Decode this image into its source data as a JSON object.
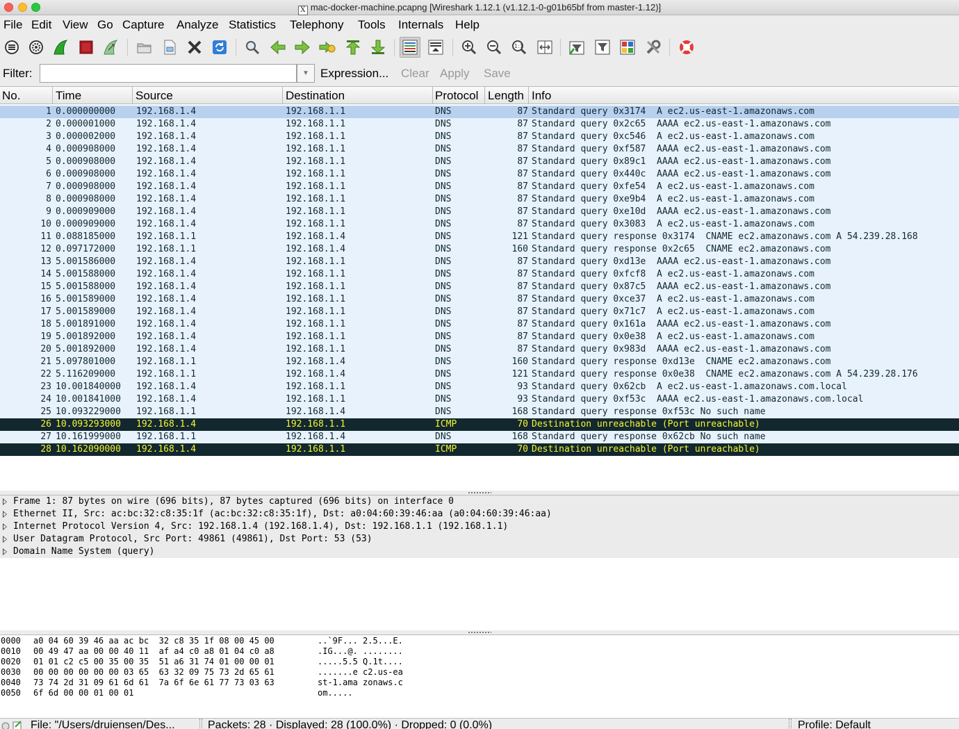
{
  "window": {
    "title": "mac-docker-machine.pcapng  [Wireshark 1.12.1  (v1.12.1-0-g01b65bf from master-1.12)]",
    "badge": "X"
  },
  "menu": [
    "File",
    "Edit",
    "View",
    "Go",
    "Capture",
    "Analyze",
    "Statistics",
    "Telephony",
    "Tools",
    "Internals",
    "Help"
  ],
  "toolbar": {
    "icons": [
      "interfaces-icon",
      "options-icon",
      "start-capture-icon",
      "stop-capture-icon",
      "restart-capture-icon",
      "open-file-icon",
      "save-file-icon",
      "close-file-icon",
      "reload-icon",
      "find-icon",
      "back-icon",
      "forward-icon",
      "go-to-packet-icon",
      "first-packet-icon",
      "last-packet-icon",
      "colorize-icon",
      "autoscroll-icon",
      "zoom-in-icon",
      "zoom-out-icon",
      "normal-size-icon",
      "resize-columns-icon",
      "capture-filters-icon",
      "display-filters-icon",
      "coloring-rules-icon",
      "preferences-icon",
      "help-icon"
    ]
  },
  "filter": {
    "label": "Filter:",
    "value": "",
    "expression": "Expression...",
    "clear": "Clear",
    "apply": "Apply",
    "save": "Save"
  },
  "packet_list": {
    "columns": [
      "No.",
      "Time",
      "Source",
      "Destination",
      "Protocol",
      "Length",
      "Info"
    ],
    "rows": [
      {
        "no": "1",
        "time": "0.000000000",
        "src": "192.168.1.4",
        "dst": "192.168.1.1",
        "proto": "DNS",
        "len": "87",
        "info": "Standard query 0x3174  A ec2.us-east-1.amazonaws.com"
      },
      {
        "no": "2",
        "time": "0.000001000",
        "src": "192.168.1.4",
        "dst": "192.168.1.1",
        "proto": "DNS",
        "len": "87",
        "info": "Standard query 0x2c65  AAAA ec2.us-east-1.amazonaws.com"
      },
      {
        "no": "3",
        "time": "0.000002000",
        "src": "192.168.1.4",
        "dst": "192.168.1.1",
        "proto": "DNS",
        "len": "87",
        "info": "Standard query 0xc546  A ec2.us-east-1.amazonaws.com"
      },
      {
        "no": "4",
        "time": "0.000908000",
        "src": "192.168.1.4",
        "dst": "192.168.1.1",
        "proto": "DNS",
        "len": "87",
        "info": "Standard query 0xf587  AAAA ec2.us-east-1.amazonaws.com"
      },
      {
        "no": "5",
        "time": "0.000908000",
        "src": "192.168.1.4",
        "dst": "192.168.1.1",
        "proto": "DNS",
        "len": "87",
        "info": "Standard query 0x89c1  AAAA ec2.us-east-1.amazonaws.com"
      },
      {
        "no": "6",
        "time": "0.000908000",
        "src": "192.168.1.4",
        "dst": "192.168.1.1",
        "proto": "DNS",
        "len": "87",
        "info": "Standard query 0x440c  AAAA ec2.us-east-1.amazonaws.com"
      },
      {
        "no": "7",
        "time": "0.000908000",
        "src": "192.168.1.4",
        "dst": "192.168.1.1",
        "proto": "DNS",
        "len": "87",
        "info": "Standard query 0xfe54  A ec2.us-east-1.amazonaws.com"
      },
      {
        "no": "8",
        "time": "0.000908000",
        "src": "192.168.1.4",
        "dst": "192.168.1.1",
        "proto": "DNS",
        "len": "87",
        "info": "Standard query 0xe9b4  A ec2.us-east-1.amazonaws.com"
      },
      {
        "no": "9",
        "time": "0.000909000",
        "src": "192.168.1.4",
        "dst": "192.168.1.1",
        "proto": "DNS",
        "len": "87",
        "info": "Standard query 0xe10d  AAAA ec2.us-east-1.amazonaws.com"
      },
      {
        "no": "10",
        "time": "0.000909000",
        "src": "192.168.1.4",
        "dst": "192.168.1.1",
        "proto": "DNS",
        "len": "87",
        "info": "Standard query 0x3083  A ec2.us-east-1.amazonaws.com"
      },
      {
        "no": "11",
        "time": "0.088185000",
        "src": "192.168.1.1",
        "dst": "192.168.1.4",
        "proto": "DNS",
        "len": "121",
        "info": "Standard query response 0x3174  CNAME ec2.amazonaws.com A 54.239.28.168"
      },
      {
        "no": "12",
        "time": "0.097172000",
        "src": "192.168.1.1",
        "dst": "192.168.1.4",
        "proto": "DNS",
        "len": "160",
        "info": "Standard query response 0x2c65  CNAME ec2.amazonaws.com"
      },
      {
        "no": "13",
        "time": "5.001586000",
        "src": "192.168.1.4",
        "dst": "192.168.1.1",
        "proto": "DNS",
        "len": "87",
        "info": "Standard query 0xd13e  AAAA ec2.us-east-1.amazonaws.com"
      },
      {
        "no": "14",
        "time": "5.001588000",
        "src": "192.168.1.4",
        "dst": "192.168.1.1",
        "proto": "DNS",
        "len": "87",
        "info": "Standard query 0xfcf8  A ec2.us-east-1.amazonaws.com"
      },
      {
        "no": "15",
        "time": "5.001588000",
        "src": "192.168.1.4",
        "dst": "192.168.1.1",
        "proto": "DNS",
        "len": "87",
        "info": "Standard query 0x87c5  AAAA ec2.us-east-1.amazonaws.com"
      },
      {
        "no": "16",
        "time": "5.001589000",
        "src": "192.168.1.4",
        "dst": "192.168.1.1",
        "proto": "DNS",
        "len": "87",
        "info": "Standard query 0xce37  A ec2.us-east-1.amazonaws.com"
      },
      {
        "no": "17",
        "time": "5.001589000",
        "src": "192.168.1.4",
        "dst": "192.168.1.1",
        "proto": "DNS",
        "len": "87",
        "info": "Standard query 0x71c7  A ec2.us-east-1.amazonaws.com"
      },
      {
        "no": "18",
        "time": "5.001891000",
        "src": "192.168.1.4",
        "dst": "192.168.1.1",
        "proto": "DNS",
        "len": "87",
        "info": "Standard query 0x161a  AAAA ec2.us-east-1.amazonaws.com"
      },
      {
        "no": "19",
        "time": "5.001892000",
        "src": "192.168.1.4",
        "dst": "192.168.1.1",
        "proto": "DNS",
        "len": "87",
        "info": "Standard query 0x0e38  A ec2.us-east-1.amazonaws.com"
      },
      {
        "no": "20",
        "time": "5.001892000",
        "src": "192.168.1.4",
        "dst": "192.168.1.1",
        "proto": "DNS",
        "len": "87",
        "info": "Standard query 0x983d  AAAA ec2.us-east-1.amazonaws.com"
      },
      {
        "no": "21",
        "time": "5.097801000",
        "src": "192.168.1.1",
        "dst": "192.168.1.4",
        "proto": "DNS",
        "len": "160",
        "info": "Standard query response 0xd13e  CNAME ec2.amazonaws.com"
      },
      {
        "no": "22",
        "time": "5.116209000",
        "src": "192.168.1.1",
        "dst": "192.168.1.4",
        "proto": "DNS",
        "len": "121",
        "info": "Standard query response 0x0e38  CNAME ec2.amazonaws.com A 54.239.28.176"
      },
      {
        "no": "23",
        "time": "10.001840000",
        "src": "192.168.1.4",
        "dst": "192.168.1.1",
        "proto": "DNS",
        "len": "93",
        "info": "Standard query 0x62cb  A ec2.us-east-1.amazonaws.com.local"
      },
      {
        "no": "24",
        "time": "10.001841000",
        "src": "192.168.1.4",
        "dst": "192.168.1.1",
        "proto": "DNS",
        "len": "93",
        "info": "Standard query 0xf53c  AAAA ec2.us-east-1.amazonaws.com.local"
      },
      {
        "no": "25",
        "time": "10.093229000",
        "src": "192.168.1.1",
        "dst": "192.168.1.4",
        "proto": "DNS",
        "len": "168",
        "info": "Standard query response 0xf53c No such name"
      },
      {
        "no": "26",
        "time": "10.093293000",
        "src": "192.168.1.4",
        "dst": "192.168.1.1",
        "proto": "ICMP",
        "len": "70",
        "info": "Destination unreachable (Port unreachable)"
      },
      {
        "no": "27",
        "time": "10.161999000",
        "src": "192.168.1.1",
        "dst": "192.168.1.4",
        "proto": "DNS",
        "len": "168",
        "info": "Standard query response 0x62cb No such name"
      },
      {
        "no": "28",
        "time": "10.162090000",
        "src": "192.168.1.4",
        "dst": "192.168.1.1",
        "proto": "ICMP",
        "len": "70",
        "info": "Destination unreachable (Port unreachable)"
      }
    ]
  },
  "details": [
    "Frame 1: 87 bytes on wire (696 bits), 87 bytes captured (696 bits) on interface 0",
    "Ethernet II, Src: ac:bc:32:c8:35:1f (ac:bc:32:c8:35:1f), Dst: a0:04:60:39:46:aa (a0:04:60:39:46:aa)",
    "Internet Protocol Version 4, Src: 192.168.1.4 (192.168.1.4), Dst: 192.168.1.1 (192.168.1.1)",
    "User Datagram Protocol, Src Port: 49861 (49861), Dst Port: 53 (53)",
    "Domain Name System (query)"
  ],
  "bytes": [
    {
      "offset": "0000",
      "hex": "a0 04 60 39 46 aa ac bc  32 c8 35 1f 08 00 45 00",
      "ascii": "..`9F... 2.5...E."
    },
    {
      "offset": "0010",
      "hex": "00 49 47 aa 00 00 40 11  af a4 c0 a8 01 04 c0 a8",
      "ascii": ".IG...@. ........"
    },
    {
      "offset": "0020",
      "hex": "01 01 c2 c5 00 35 00 35  51 a6 31 74 01 00 00 01",
      "ascii": ".....5.5 Q.1t...."
    },
    {
      "offset": "0030",
      "hex": "00 00 00 00 00 00 03 65  63 32 09 75 73 2d 65 61",
      "ascii": ".......e c2.us-ea"
    },
    {
      "offset": "0040",
      "hex": "73 74 2d 31 09 61 6d 61  7a 6f 6e 61 77 73 03 63",
      "ascii": "st-1.ama zonaws.c"
    },
    {
      "offset": "0050",
      "hex": "6f 6d 00 00 01 00 01",
      "ascii": "om....."
    }
  ],
  "status": {
    "file": "File: \"/Users/druiensen/Des...",
    "packets": "Packets: 28 · Displayed: 28 (100.0%) · Dropped: 0 (0.0%)",
    "profile": "Profile: Default"
  },
  "colors": {
    "row_bg": "#e7f2fc",
    "row_selected": "#b8d1ef",
    "icmp_bg": "#12272e",
    "icmp_fg": "#f7f632"
  }
}
